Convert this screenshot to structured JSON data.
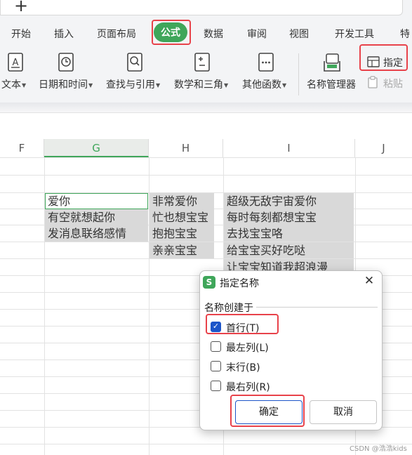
{
  "menu": {
    "items": [
      "开始",
      "插入",
      "页面布局",
      "公式",
      "数据",
      "审阅",
      "视图",
      "开发工具",
      "特"
    ],
    "active": "公式"
  },
  "ribbon": {
    "text_func": "文本",
    "datetime": "日期和时间",
    "lookup": "查找与引用",
    "math": "数学和三角",
    "other": "其他函数",
    "name_manager": "名称管理器",
    "define": "指定",
    "paste": "粘贴"
  },
  "sheet": {
    "columns": [
      "F",
      "G",
      "H",
      "I",
      "J"
    ],
    "selected_column": "G",
    "col_g": [
      "爱你",
      "有空就想起你",
      "发消息联络感情"
    ],
    "col_h": [
      "非常爱你",
      "忙也想宝宝",
      "抱抱宝宝",
      "亲亲宝宝"
    ],
    "col_i": [
      "超级无敌宇宙爱你",
      "每时每刻都想宝宝",
      "去找宝宝咯",
      "给宝宝买好吃哒",
      "让宝宝知道我超浪漫"
    ]
  },
  "dialog": {
    "title": "指定名称",
    "group": "名称创建于",
    "options": [
      {
        "label": "首行(T)",
        "checked": true
      },
      {
        "label": "最左列(L)",
        "checked": false
      },
      {
        "label": "末行(B)",
        "checked": false
      },
      {
        "label": "最右列(R)",
        "checked": false
      }
    ],
    "ok": "确定",
    "cancel": "取消"
  },
  "watermark": "CSDN @浩浩kids",
  "colors": {
    "accent": "#3fa65a",
    "highlight": "#e8424a",
    "check": "#1d55c9"
  },
  "icons": [
    "plus-icon",
    "text-function-icon",
    "calendar-clock-icon",
    "search-book-icon",
    "math-book-icon",
    "more-functions-icon",
    "name-manager-icon",
    "define-name-icon",
    "paste-icon",
    "close-icon",
    "check-icon"
  ]
}
